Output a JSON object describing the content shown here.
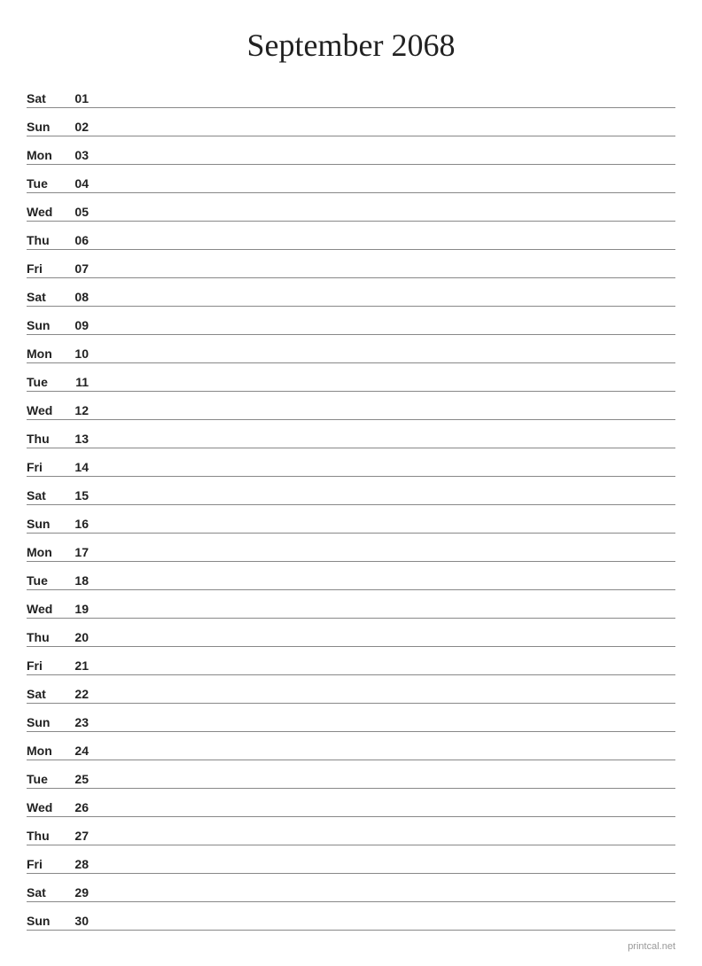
{
  "title": "September 2068",
  "watermark": "printcal.net",
  "days": [
    {
      "name": "Sat",
      "num": "01"
    },
    {
      "name": "Sun",
      "num": "02"
    },
    {
      "name": "Mon",
      "num": "03"
    },
    {
      "name": "Tue",
      "num": "04"
    },
    {
      "name": "Wed",
      "num": "05"
    },
    {
      "name": "Thu",
      "num": "06"
    },
    {
      "name": "Fri",
      "num": "07"
    },
    {
      "name": "Sat",
      "num": "08"
    },
    {
      "name": "Sun",
      "num": "09"
    },
    {
      "name": "Mon",
      "num": "10"
    },
    {
      "name": "Tue",
      "num": "11"
    },
    {
      "name": "Wed",
      "num": "12"
    },
    {
      "name": "Thu",
      "num": "13"
    },
    {
      "name": "Fri",
      "num": "14"
    },
    {
      "name": "Sat",
      "num": "15"
    },
    {
      "name": "Sun",
      "num": "16"
    },
    {
      "name": "Mon",
      "num": "17"
    },
    {
      "name": "Tue",
      "num": "18"
    },
    {
      "name": "Wed",
      "num": "19"
    },
    {
      "name": "Thu",
      "num": "20"
    },
    {
      "name": "Fri",
      "num": "21"
    },
    {
      "name": "Sat",
      "num": "22"
    },
    {
      "name": "Sun",
      "num": "23"
    },
    {
      "name": "Mon",
      "num": "24"
    },
    {
      "name": "Tue",
      "num": "25"
    },
    {
      "name": "Wed",
      "num": "26"
    },
    {
      "name": "Thu",
      "num": "27"
    },
    {
      "name": "Fri",
      "num": "28"
    },
    {
      "name": "Sat",
      "num": "29"
    },
    {
      "name": "Sun",
      "num": "30"
    }
  ]
}
